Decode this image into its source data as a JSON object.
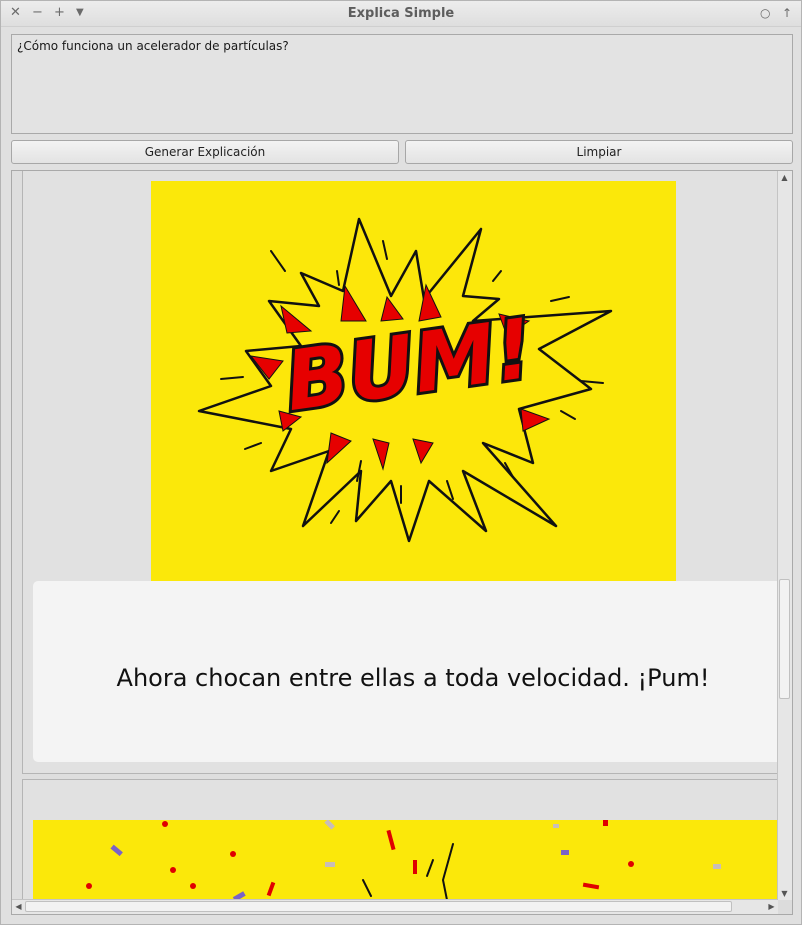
{
  "window": {
    "title": "Explica Simple",
    "controls_left": [
      "close-icon",
      "minimize-icon",
      "maximize-icon",
      "menu-icon"
    ],
    "controls_right": [
      "restore-icon",
      "pin-icon"
    ]
  },
  "question": {
    "value": "¿Cómo funciona un acelerador de partículas?"
  },
  "buttons": {
    "generate_label": "Generar Explicación",
    "clear_label": "Limpiar"
  },
  "results": [
    {
      "image": {
        "text": "BUM!",
        "background": "#fbe80a",
        "accent": "#ff0000"
      },
      "caption": "Ahora chocan entre ellas a toda velocidad. ¡Pum!"
    },
    {
      "image": {
        "background": "#fbe80a",
        "confetti_colors": [
          "#e00000",
          "#7a62c8",
          "#c8bdb8"
        ]
      }
    }
  ]
}
